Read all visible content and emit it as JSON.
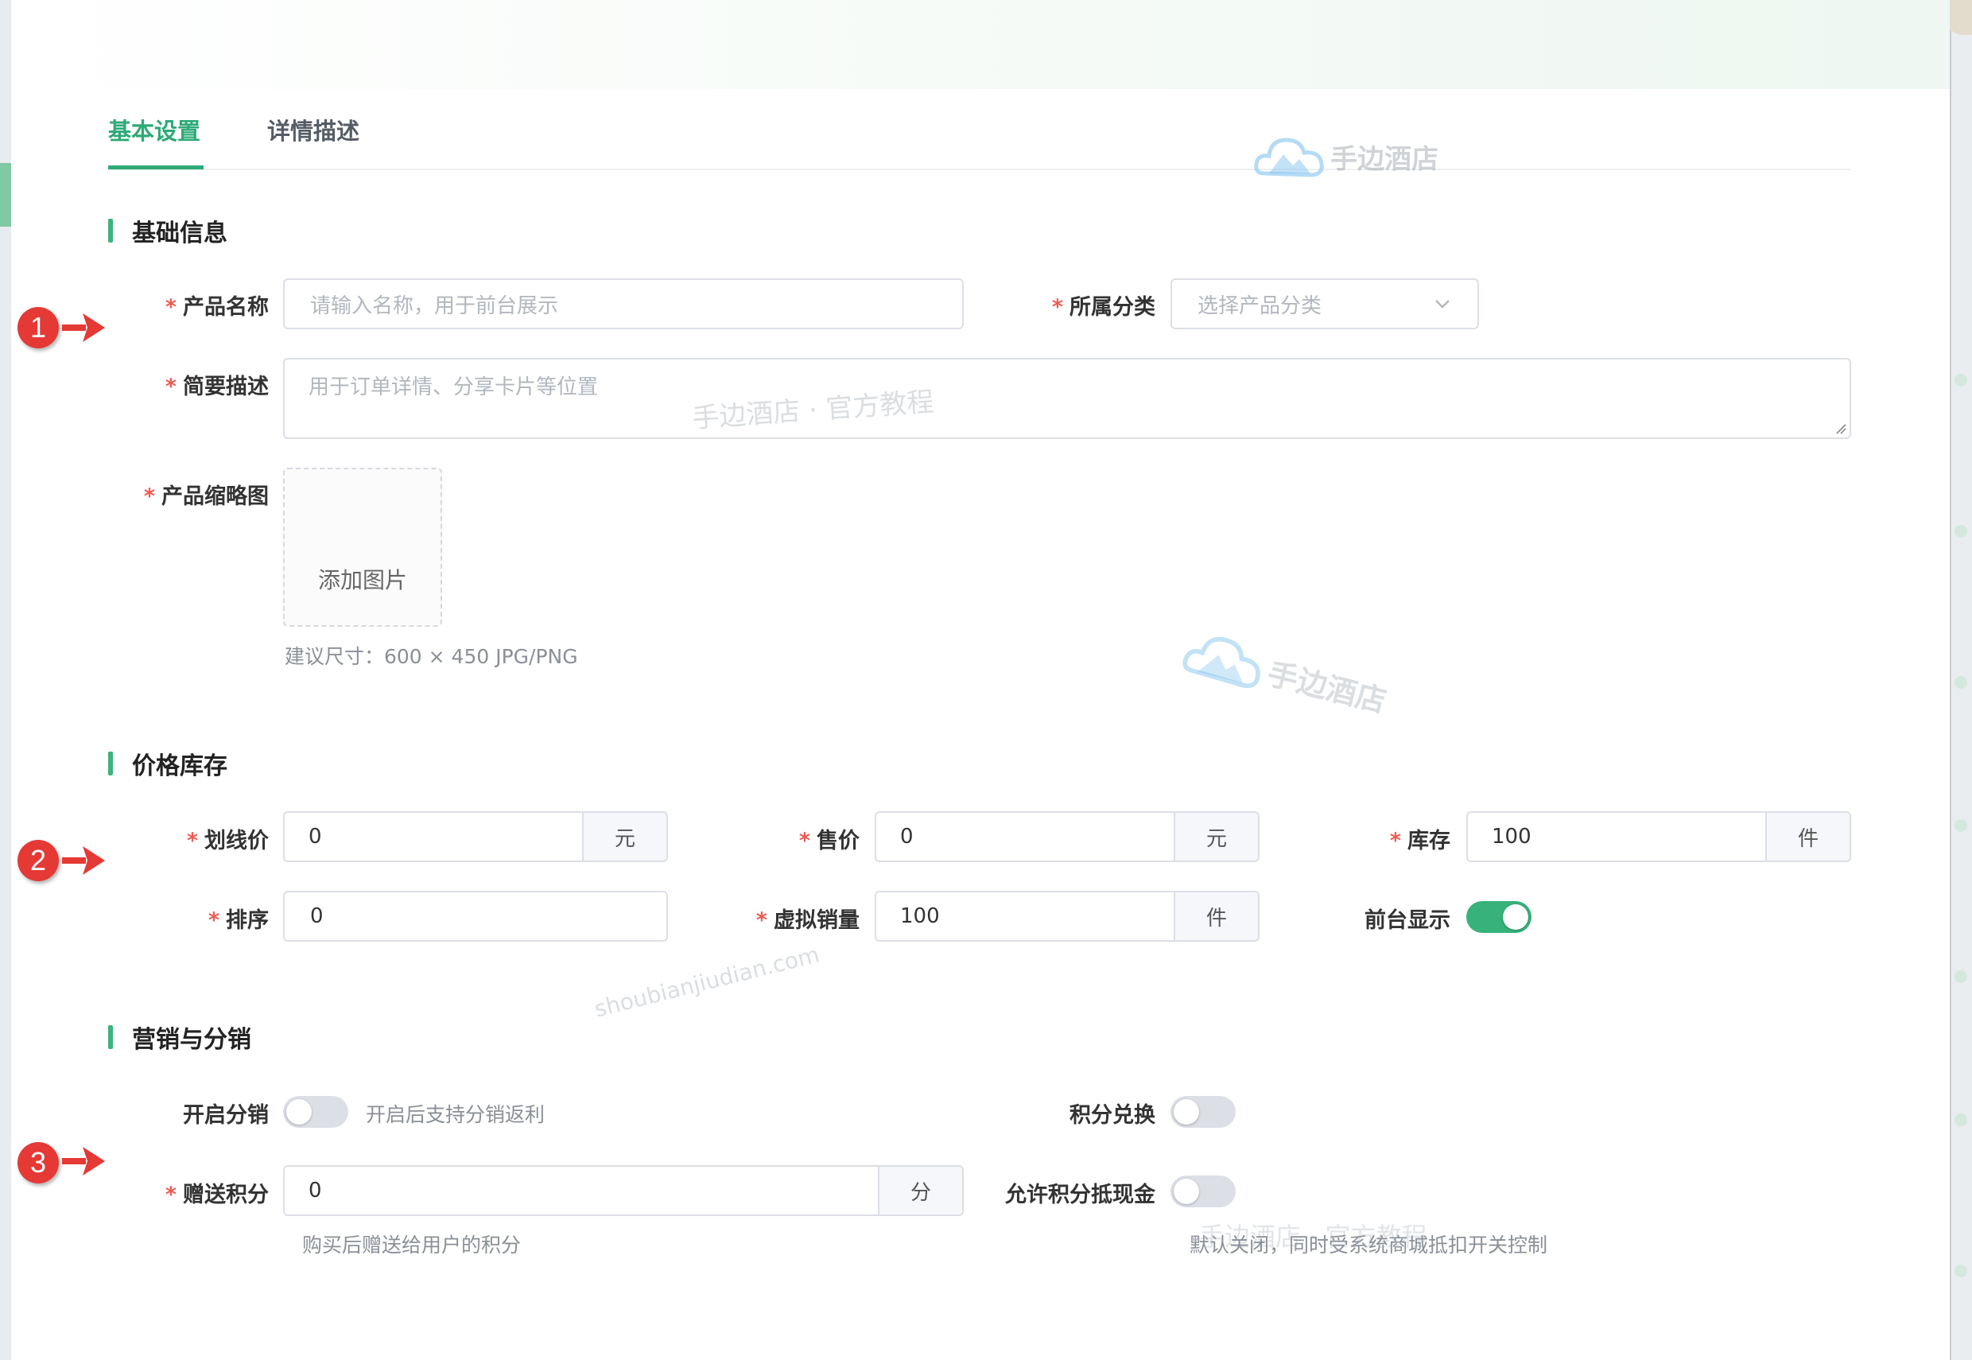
{
  "tabs": [
    {
      "label": "基本设置",
      "active": true
    },
    {
      "label": "详情描述",
      "active": false
    }
  ],
  "sections": {
    "basic": {
      "title": "基础信息",
      "product_name_label": "产品名称",
      "product_name_placeholder": "请输入名称，用于前台展示",
      "category_label": "所属分类",
      "category_placeholder": "选择产品分类",
      "summary_label": "简要描述",
      "summary_placeholder": "用于订单详情、分享卡片等位置",
      "thumbnail_label": "产品缩略图",
      "upload_text": "添加图片",
      "thumbnail_hint": "建议尺寸：600 × 450 JPG/PNG"
    },
    "price": {
      "title": "价格库存",
      "list_price_label": "划线价",
      "list_price_value": "0",
      "list_price_unit": "元",
      "sale_price_label": "售价",
      "sale_price_value": "0",
      "sale_price_unit": "元",
      "stock_label": "库存",
      "stock_value": "100",
      "stock_unit": "件",
      "sort_label": "排序",
      "sort_value": "0",
      "virtual_sales_label": "虚拟销量",
      "virtual_sales_value": "100",
      "virtual_sales_unit": "件",
      "frontend_display_label": "前台显示",
      "frontend_display_on": true
    },
    "marketing": {
      "title": "营销与分销",
      "distribution_label": "开启分销",
      "distribution_on": false,
      "distribution_hint": "开启后支持分销返利",
      "points_exchange_label": "积分兑换",
      "points_exchange_on": false,
      "gift_points_label": "赠送积分",
      "gift_points_value": "0",
      "gift_points_unit": "分",
      "gift_points_hint": "购买后赠送给用户的积分",
      "points_cash_label": "允许积分抵现金",
      "points_cash_on": false,
      "points_cash_hint": "默认关闭，同时受系统商城抵扣开关控制"
    }
  },
  "required_mark": "*",
  "annotations": [
    "1",
    "2",
    "3"
  ],
  "watermarks": {
    "brand": "手边酒店",
    "tutorial": "手边酒店 · 官方教程",
    "domain": "shoubianjiudian.com"
  },
  "colors": {
    "accent": "#2eaa77",
    "required": "#f05a50",
    "annotation": "#e53935"
  }
}
